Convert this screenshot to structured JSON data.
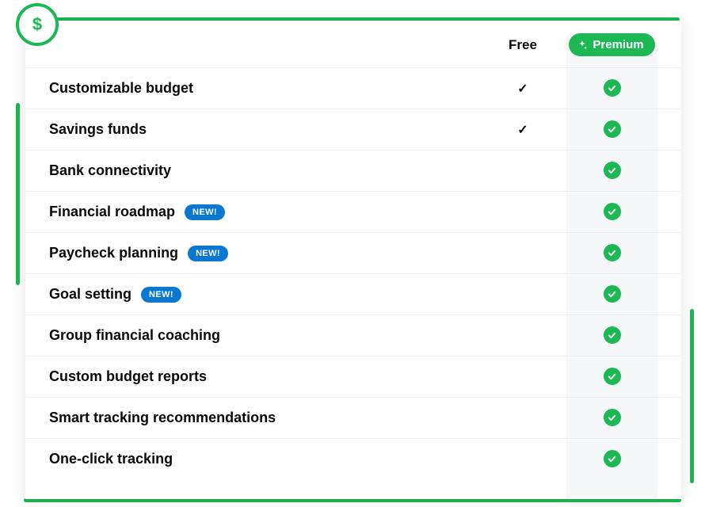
{
  "columns": {
    "free_label": "Free",
    "premium_label": "Premium"
  },
  "badge_new_label": "NEW!",
  "features": [
    {
      "name": "Customizable budget",
      "is_new": false,
      "free": true,
      "premium": true
    },
    {
      "name": "Savings funds",
      "is_new": false,
      "free": true,
      "premium": true
    },
    {
      "name": "Bank connectivity",
      "is_new": false,
      "free": false,
      "premium": true
    },
    {
      "name": "Financial roadmap",
      "is_new": true,
      "free": false,
      "premium": true
    },
    {
      "name": "Paycheck planning",
      "is_new": true,
      "free": false,
      "premium": true
    },
    {
      "name": "Goal setting",
      "is_new": true,
      "free": false,
      "premium": true
    },
    {
      "name": "Group financial coaching",
      "is_new": false,
      "free": false,
      "premium": true
    },
    {
      "name": "Custom budget reports",
      "is_new": false,
      "free": false,
      "premium": true
    },
    {
      "name": "Smart tracking recommendations",
      "is_new": false,
      "free": false,
      "premium": true
    },
    {
      "name": "One-click tracking",
      "is_new": false,
      "free": false,
      "premium": true
    }
  ]
}
